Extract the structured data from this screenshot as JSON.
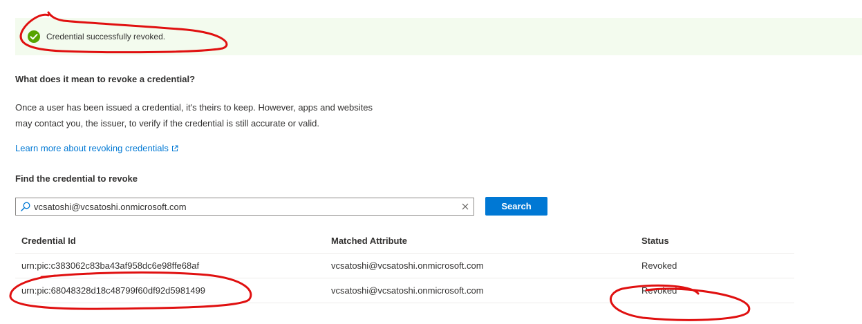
{
  "banner": {
    "message": "Credential successfully revoked.",
    "icon": "checkmark-circle-icon",
    "icon_color": "#57a300",
    "background": "#f3fbee"
  },
  "info": {
    "heading": "What does it mean to revoke a credential?",
    "paragraph_line1": "Once a user has been issued a credential, it's theirs to keep. However, apps and websites",
    "paragraph_line2": "may contact you, the issuer, to verify if the credential is still accurate or valid.",
    "learn_more": "Learn more about revoking credentials"
  },
  "search": {
    "heading": "Find the credential to revoke",
    "value": "vcsatoshi@vcsatoshi.onmicrosoft.com",
    "button_label": "Search",
    "button_color": "#0078d4"
  },
  "table": {
    "columns": [
      "Credential Id",
      "Matched Attribute",
      "Status"
    ],
    "rows": [
      {
        "credential_id": "urn:pic:c383062c83ba43af958dc6e98ffe68af",
        "matched_attribute": "vcsatoshi@vcsatoshi.onmicrosoft.com",
        "status": "Revoked"
      },
      {
        "credential_id": "urn:pic:68048328d18c48799f60df92d5981499",
        "matched_attribute": "vcsatoshi@vcsatoshi.onmicrosoft.com",
        "status": "Revoked"
      }
    ]
  },
  "annotation_color": "#e01010"
}
